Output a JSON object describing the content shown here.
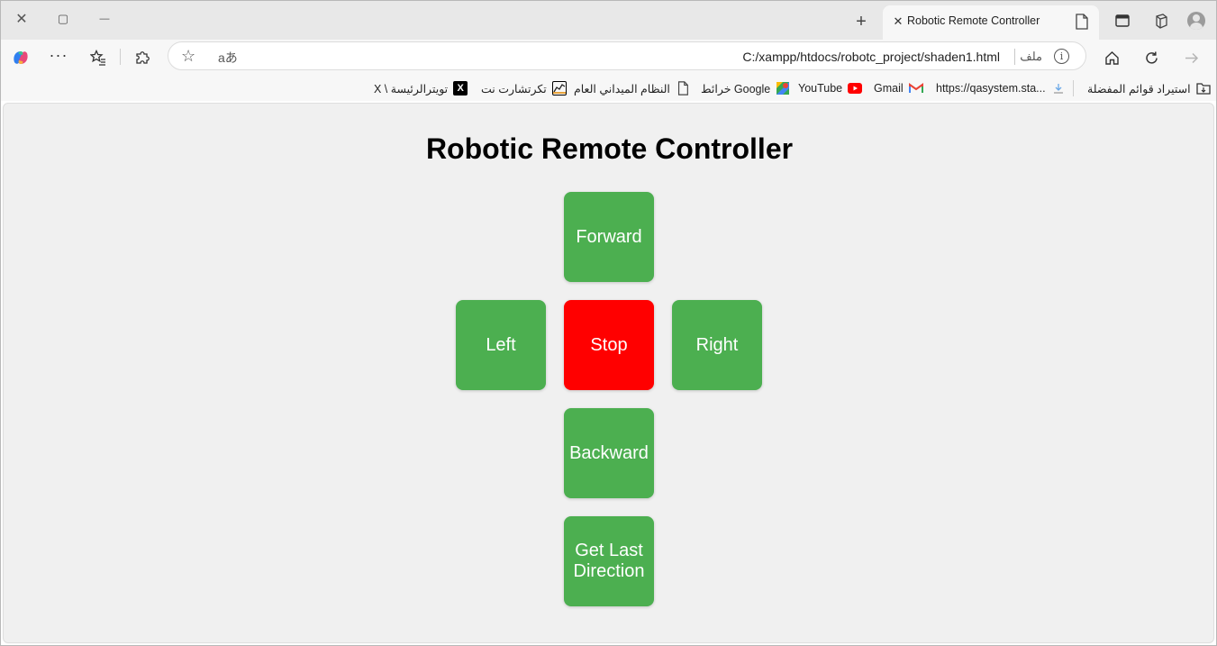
{
  "window": {
    "close_glyph": "✕",
    "maximize_glyph": "▢",
    "minimize_glyph": "—"
  },
  "tab": {
    "title": "Robotic Remote Controller",
    "close_glyph": "✕",
    "new_tab_glyph": "+"
  },
  "address_bar": {
    "url": "C:/xampp/htdocs/robotc_project/shaden1.html",
    "file_label": "ملف",
    "info_glyph": "i",
    "read_aloud_label": "aあ",
    "star_glyph": "☆"
  },
  "bookmarks": [
    {
      "label": "X \\ تويترالرئيسة",
      "icon": "x-logo-icon"
    },
    {
      "label": "تكرتشارت نت",
      "icon": "chart-icon"
    },
    {
      "label": "النظام الميداني العام",
      "icon": "page-icon"
    },
    {
      "label": "خرائط Google",
      "icon": "maps-icon"
    },
    {
      "label": "YouTube",
      "icon": "youtube-icon"
    },
    {
      "label": "Gmail",
      "icon": "gmail-icon"
    },
    {
      "label": "https://qasystem.sta...",
      "icon": "download-icon"
    },
    {
      "label": "استيراد قوائم المفضلة",
      "icon": "import-icon"
    }
  ],
  "page": {
    "heading": "Robotic Remote Controller",
    "buttons": {
      "forward": "Forward",
      "left": "Left",
      "stop": "Stop",
      "right": "Right",
      "backward": "Backward",
      "last_direction": "Get Last Direction"
    }
  },
  "colors": {
    "move_button": "#4caf50",
    "stop_button": "#ff0000",
    "page_background": "#f0f0f0"
  }
}
